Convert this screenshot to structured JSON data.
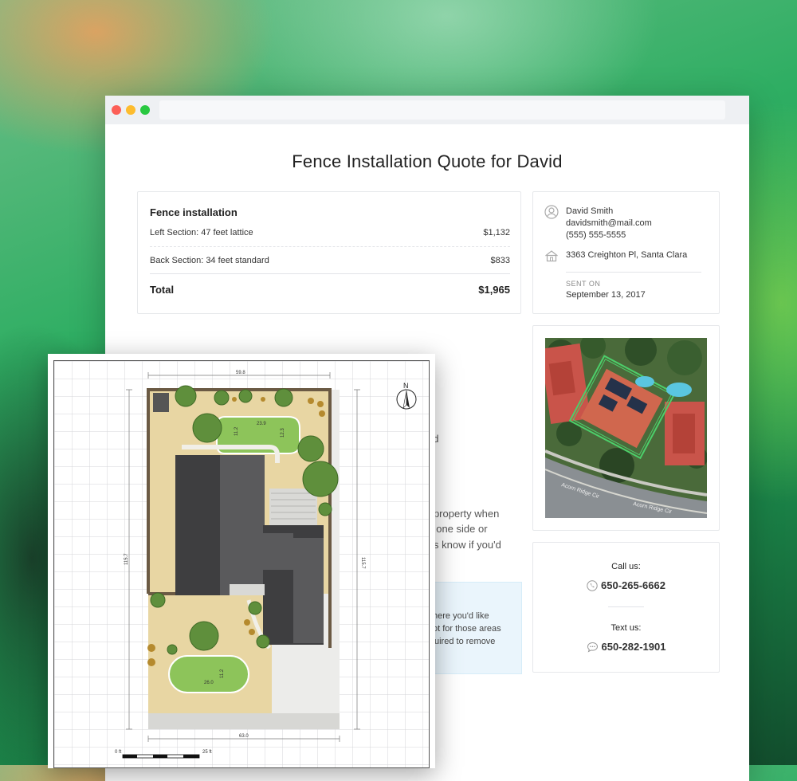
{
  "page": {
    "title": "Fence Installation Quote for David"
  },
  "quote": {
    "heading": "Fence installation",
    "items": [
      {
        "label": "Left Section: 47 feet lattice",
        "amount": "$1,132"
      },
      {
        "label": "Back Section: 34 feet standard",
        "amount": "$833"
      }
    ],
    "total_label": "Total",
    "total_amount": "$1,965"
  },
  "contact": {
    "name": "David Smith",
    "email": "davidsmith@mail.com",
    "phone": "(555) 555-5555",
    "address": "3363 Creighton Pl, Santa Clara",
    "sent_label": "SENT ON",
    "sent_date": "September 13, 2017"
  },
  "call": {
    "call_label": "Call us:",
    "call_number": "650-265-6662",
    "text_label": "Text us:",
    "text_number": "650-282-1901"
  },
  "body_fragments": [
    "nd",
    "r property when",
    "t one side or",
    "s know if you'd"
  ],
  "info_fragments": [
    "here you'd like",
    "ot for those areas",
    "uired to remove"
  ],
  "plan": {
    "dim_top": "59.8",
    "dim_bottom": "63.0",
    "dim_left": "115.7",
    "dim_right": "115.7",
    "lawn1_w": "23.9",
    "lawn1_h1": "11.2",
    "lawn1_h2": "12.3",
    "lawn2_w": "26.0",
    "lawn2_h": "11.2",
    "compass": "N",
    "scale_start": "0 ft",
    "scale_end": "25 ft"
  },
  "map": {
    "street1": "Acorn Ridge Cir",
    "street2": "Acorn Ridge Cir"
  },
  "colors": {
    "accent_green": "#4ccf6a",
    "fence_brown": "#6b5a44",
    "lawn_green": "#8dc45a"
  },
  "icons": [
    "user-icon",
    "house-icon",
    "phone-icon",
    "chat-icon",
    "compass-icon"
  ]
}
